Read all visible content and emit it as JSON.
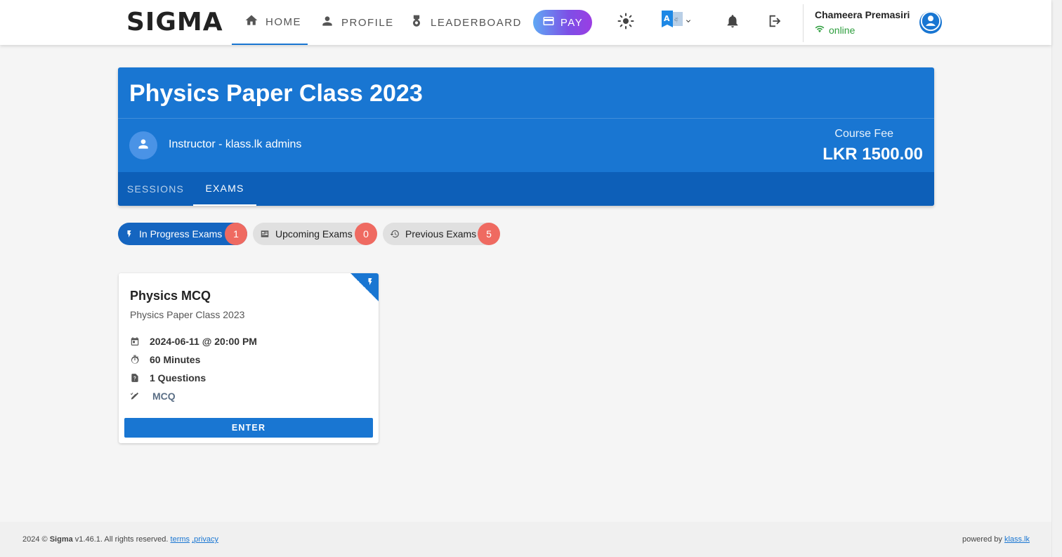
{
  "app": {
    "logo": "SIGMA"
  },
  "nav": {
    "home": "HOME",
    "profile": "PROFILE",
    "leaderboard": "LEADERBOARD",
    "pay": "PAY"
  },
  "user": {
    "name": "Chameera Premasiri",
    "status": "online"
  },
  "course": {
    "title": "Physics Paper Class 2023",
    "instructor": "Instructor - klass.lk admins",
    "fee_label": "Course Fee",
    "fee_value": "LKR 1500.00",
    "tabs": [
      {
        "label": "SESSIONS",
        "active": false
      },
      {
        "label": "EXAMS",
        "active": true
      }
    ]
  },
  "filters": [
    {
      "label": "In Progress Exams",
      "count": "1",
      "icon": "bolt-icon",
      "active": true
    },
    {
      "label": "Upcoming Exams",
      "count": "0",
      "icon": "news-icon",
      "active": false
    },
    {
      "label": "Previous Exams",
      "count": "5",
      "icon": "history-icon",
      "active": false
    }
  ],
  "exam": {
    "title": "Physics MCQ",
    "subtitle": "Physics Paper Class 2023",
    "datetime": "2024-06-11 @ 20:00 PM",
    "duration": "60 Minutes",
    "questions": "1 Questions",
    "type": "MCQ",
    "enter_label": "ENTER"
  },
  "footer": {
    "copyright_prefix": "2024 ©",
    "brand": "Sigma",
    "version": "v1.46.1. All rights reserved.",
    "terms": "terms",
    "privacy": ",privacy",
    "powered_by": "powered by",
    "powered_link": "klass.lk"
  },
  "colors": {
    "primary": "#1976d2",
    "tabbar": "#0d5fb8",
    "badge": "#ef6a61",
    "online": "#2e9e3e"
  }
}
